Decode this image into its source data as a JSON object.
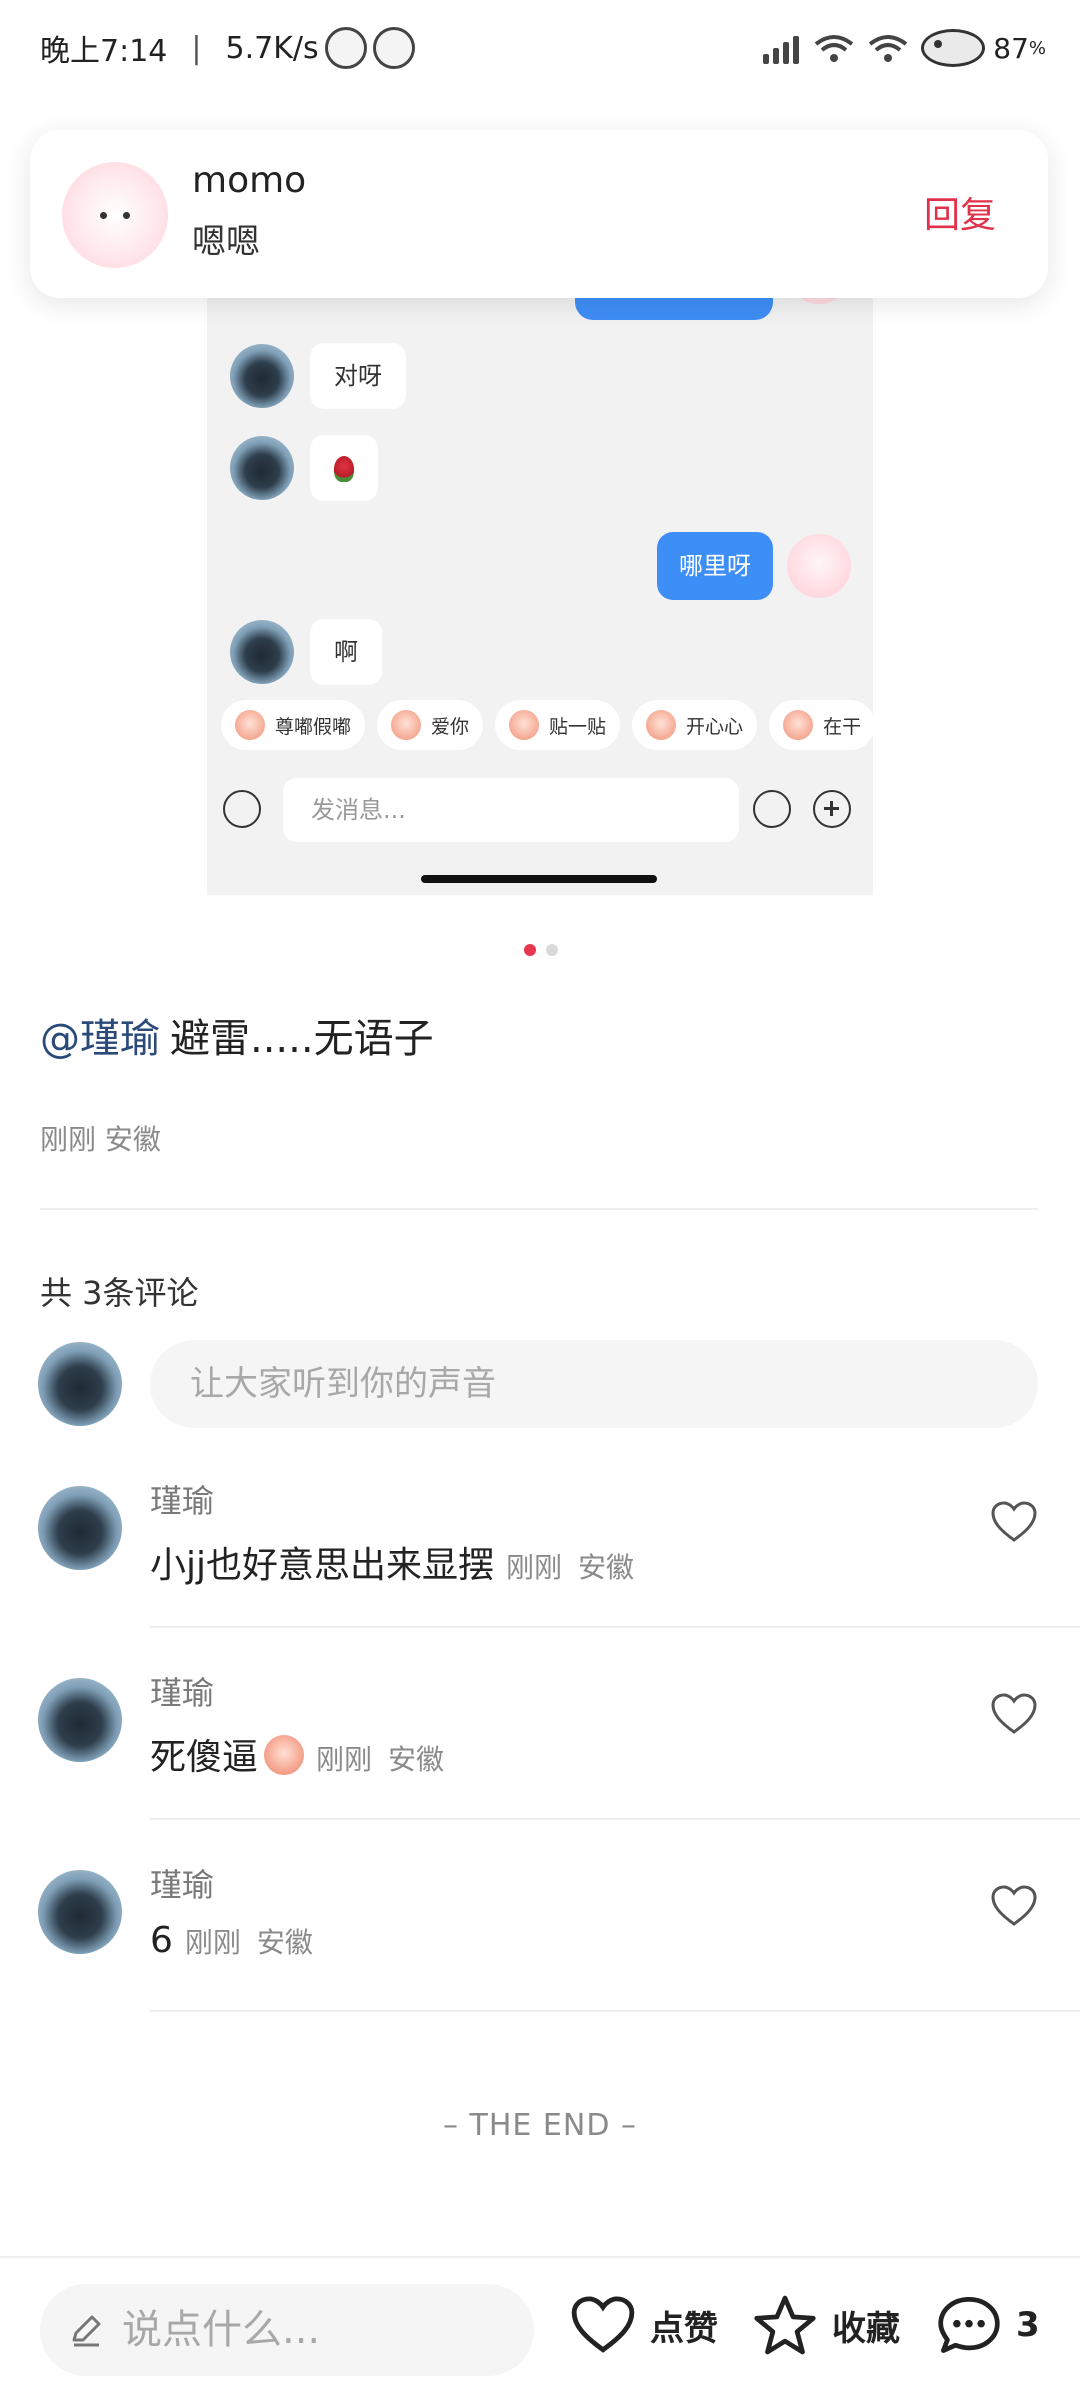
{
  "status_bar": {
    "time": "晚上7:14",
    "net_speed": "5.7K/s",
    "battery": "87"
  },
  "notification": {
    "sender": "momo",
    "message": "嗯嗯",
    "reply_label": "回复"
  },
  "screenshot": {
    "messages": [
      {
        "side": "left",
        "text": "对呀"
      },
      {
        "side": "left",
        "type": "rose-emoji"
      },
      {
        "side": "right",
        "text": "哪里呀"
      },
      {
        "side": "left",
        "text": "啊"
      }
    ],
    "quick_replies": [
      "尊嘟假嘟",
      "爱你",
      "贴一贴",
      "开心心",
      "在干"
    ],
    "input_placeholder": "发消息..."
  },
  "carousel": {
    "pages": 2,
    "current": 1
  },
  "post": {
    "mention": "@瑾瑜",
    "text": "避雷.....无语子",
    "time": "刚刚",
    "location": "安徽"
  },
  "comments_section": {
    "count_label": "共 3条评论",
    "input_placeholder": "让大家听到你的声音",
    "items": [
      {
        "user": "瑾瑜",
        "text": "小jj也好意思出来显摆",
        "emoji": false,
        "time": "刚刚",
        "location": "安徽"
      },
      {
        "user": "瑾瑜",
        "text": "死傻逼",
        "emoji": true,
        "time": "刚刚",
        "location": "安徽"
      },
      {
        "user": "瑾瑜",
        "text": "6",
        "emoji": false,
        "time": "刚刚",
        "location": "安徽"
      }
    ]
  },
  "end_label": "– THE END –",
  "bottom_bar": {
    "input_placeholder": "说点什么...",
    "like_label": "点赞",
    "collect_label": "收藏",
    "comment_count": "3"
  },
  "colors": {
    "accent_red": "#e0324a",
    "bubble_blue": "#3e8ef7",
    "mention_blue": "#2a4a7a"
  }
}
